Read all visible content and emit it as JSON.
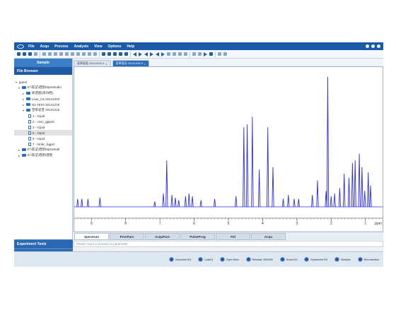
{
  "menubar": {
    "items": [
      "File",
      "Acqu",
      "Process",
      "Analysis",
      "View",
      "Options",
      "Help"
    ]
  },
  "sidebar": {
    "sample_tab": "Sample",
    "file_browser_tab": "File Browser",
    "tree": [
      {
        "label": "guest",
        "kind": "root",
        "expanded": true
      },
      {
        "label": "E:\\笔记\\谱图\\SpinStudio",
        "kind": "folder",
        "expanded": true
      },
      {
        "label": "新谱图(未归档)",
        "kind": "folder",
        "expanded": false
      },
      {
        "label": "Liver_H1.20141204",
        "kind": "folder",
        "expanded": false
      },
      {
        "label": "Na TEST.20141216",
        "kind": "folder",
        "expanded": false
      },
      {
        "label": "苷草皂苷.20141216",
        "kind": "folder",
        "expanded": true
      },
      {
        "label": "1 - s1pul",
        "kind": "file"
      },
      {
        "label": "2 - cosc_gpprsl",
        "kind": "file"
      },
      {
        "label": "3 - s1pul",
        "kind": "file"
      },
      {
        "label": "5 - s1pul",
        "kind": "file",
        "selected": true
      },
      {
        "label": "6 - s1pul",
        "kind": "file"
      },
      {
        "label": "7 - hmbc_bgpsl",
        "kind": "file"
      },
      {
        "label": "E:\\笔记\\谱图\\SpinStudi",
        "kind": "folder",
        "expanded": false
      },
      {
        "label": "E:\\笔记\\谱图\\谱图",
        "kind": "folder",
        "expanded": false
      }
    ],
    "experiment_tools": "Experiment Tools",
    "compound_tools": "Compound Tools"
  },
  "doc_tabs": [
    {
      "label": "苷草皂苷.20141216 3",
      "active": false
    },
    {
      "label": "苷草皂苷.20141216 5",
      "active": true
    }
  ],
  "bottom_tabs": [
    "Spectrum",
    "ProcPars",
    "AcquPars",
    "PulseProg",
    "Fid",
    "Acqu"
  ],
  "active_bottom_tab": "Spectrum",
  "command_placeholder": "Please input command or parameter",
  "statusbar": {
    "items": [
      "Document  5/4",
      "Lock(H)",
      "Open Shim",
      "Residual: 0000000",
      "Scans 0/0",
      "Experiment 0/0",
      "Samples",
      "Reconnection"
    ]
  },
  "colors": {
    "menubar": "#1b5aa6",
    "spectrum": "#2d2df0",
    "axis": "#333333"
  },
  "chart_data": {
    "type": "line",
    "title": "",
    "xlabel": "",
    "ylabel": "",
    "x_ticks": [
      "9",
      "8",
      "7",
      "6",
      "5",
      "4",
      "3",
      "2",
      "1",
      "ppm"
    ],
    "xlim": [
      9.5,
      0.5
    ],
    "ylim": [
      0,
      100
    ],
    "x_reversed": true,
    "peaks": [
      {
        "x": 9.4,
        "h": 6
      },
      {
        "x": 9.28,
        "h": 6
      },
      {
        "x": 9.1,
        "h": 6
      },
      {
        "x": 8.75,
        "h": 7
      },
      {
        "x": 7.15,
        "h": 4
      },
      {
        "x": 6.9,
        "h": 10
      },
      {
        "x": 6.8,
        "h": 35
      },
      {
        "x": 6.65,
        "h": 9
      },
      {
        "x": 6.55,
        "h": 7
      },
      {
        "x": 6.45,
        "h": 5
      },
      {
        "x": 6.25,
        "h": 8
      },
      {
        "x": 6.15,
        "h": 10
      },
      {
        "x": 6.05,
        "h": 8
      },
      {
        "x": 5.8,
        "h": 5
      },
      {
        "x": 5.4,
        "h": 6
      },
      {
        "x": 4.78,
        "h": 8
      },
      {
        "x": 4.55,
        "h": 60
      },
      {
        "x": 4.45,
        "h": 62
      },
      {
        "x": 4.3,
        "h": 68
      },
      {
        "x": 4.1,
        "h": 28
      },
      {
        "x": 3.85,
        "h": 60
      },
      {
        "x": 3.7,
        "h": 30
      },
      {
        "x": 3.4,
        "h": 6
      },
      {
        "x": 3.25,
        "h": 9
      },
      {
        "x": 3.08,
        "h": 6
      },
      {
        "x": 2.95,
        "h": 6
      },
      {
        "x": 2.55,
        "h": 9
      },
      {
        "x": 2.4,
        "h": 20
      },
      {
        "x": 2.15,
        "h": 12
      },
      {
        "x": 2.1,
        "h": 98
      },
      {
        "x": 2.0,
        "h": 8
      },
      {
        "x": 1.9,
        "h": 10
      },
      {
        "x": 1.75,
        "h": 14
      },
      {
        "x": 1.62,
        "h": 25
      },
      {
        "x": 1.48,
        "h": 22
      },
      {
        "x": 1.38,
        "h": 33
      },
      {
        "x": 1.3,
        "h": 35
      },
      {
        "x": 1.18,
        "h": 40
      },
      {
        "x": 1.1,
        "h": 30
      },
      {
        "x": 1.02,
        "h": 12
      },
      {
        "x": 0.92,
        "h": 26
      },
      {
        "x": 0.85,
        "h": 16
      }
    ]
  }
}
